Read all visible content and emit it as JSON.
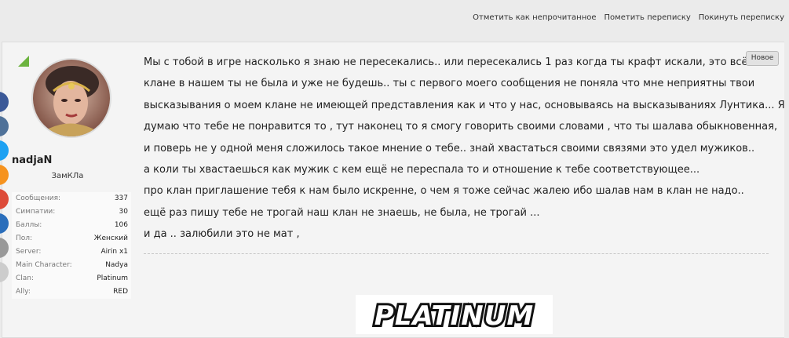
{
  "topbar": {
    "links": [
      "Отметить как непрочитанное",
      "Пометить переписку",
      "Покинуть переписку"
    ]
  },
  "user": {
    "name": "nadjaN",
    "title": "ЗамКЛа",
    "stats": [
      {
        "k": "Сообщения:",
        "v": "337"
      },
      {
        "k": "Симпатии:",
        "v": "30"
      },
      {
        "k": "Баллы:",
        "v": "106"
      },
      {
        "k": "Пол:",
        "v": "Женский"
      },
      {
        "k": "Server:",
        "v": "Airin x1"
      },
      {
        "k": "Main Character:",
        "v": "Nadya"
      },
      {
        "k": "Clan:",
        "v": "Platinum"
      },
      {
        "k": "Ally:",
        "v": "RED"
      }
    ],
    "social_colors": [
      "#3b5998",
      "#507299",
      "#1da1f2",
      "#f6931f",
      "#dd4b39",
      "#2a6ebb",
      "#999999",
      "#cccccc"
    ]
  },
  "post": {
    "badge": "Новое",
    "lines": [
      "Мы с тобой в игре насколько я знаю не пересекались.. или пересекались 1 раз когда ты крафт искали, это всё.. в",
      "клане в нашем ты не была и уже не будешь.. ты с первого моего сообщения не поняла что мне неприятны твои",
      "высказывания о моем клане не имеющей представления как и что у нас, основываясь на высказываниях Лунтика... Я",
      "думаю что тебе не понравится то , тут наконец то я смогу говорить своими словами , что ты шалава обыкновенная,",
      "и поверь не у одной меня сложилось такое мнение о тебе.. знай хвастаться своими связями это удел мужиков..",
      "а коли ты хвастаешься как мужик с кем ещё не переспала то и отношение к тебе соответствующее...",
      "про клан приглашение тебя к нам было искренне, о чем я тоже сейчас жалею ибо шалав нам в клан не надо..",
      "ещё раз пишу тебе не трогай наш клан не знаешь, не была, не трогай ...",
      "и да .. залюбили это не мат ,"
    ]
  },
  "signature": {
    "logo_text": "PLATINUM"
  }
}
